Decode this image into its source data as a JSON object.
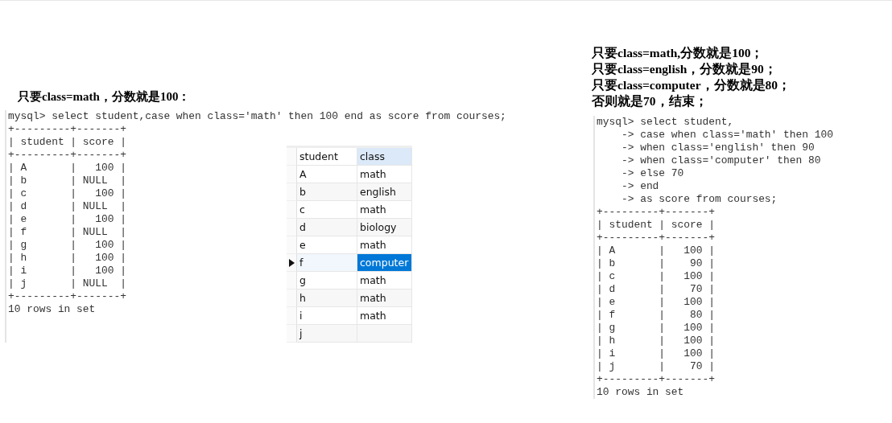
{
  "left": {
    "note": "只要class=math，分数就是100：",
    "command": "mysql> select student,case when class='math' then 100 end as score from courses;",
    "output": [
      "+---------+-------+",
      "| student | score |",
      "+---------+-------+",
      "| A       |   100 |",
      "| b       | NULL  |",
      "| c       |   100 |",
      "| d       | NULL  |",
      "| e       |   100 |",
      "| f       | NULL  |",
      "| g       |   100 |",
      "| h       |   100 |",
      "| i       |   100 |",
      "| j       | NULL  |",
      "+---------+-------+",
      "10 rows in set"
    ]
  },
  "grid": {
    "columns": [
      {
        "label": "student",
        "selected": false
      },
      {
        "label": "class",
        "selected": true
      }
    ],
    "rows": [
      {
        "student": "A",
        "class": "math",
        "selected": false
      },
      {
        "student": "b",
        "class": "english",
        "selected": false
      },
      {
        "student": "c",
        "class": "math",
        "selected": false
      },
      {
        "student": "d",
        "class": "biology",
        "selected": false
      },
      {
        "student": "e",
        "class": "math",
        "selected": false
      },
      {
        "student": "f",
        "class": "computer",
        "selected": true
      },
      {
        "student": "g",
        "class": "math",
        "selected": false
      },
      {
        "student": "h",
        "class": "math",
        "selected": false
      },
      {
        "student": "i",
        "class": "math",
        "selected": false
      },
      {
        "student": "j",
        "class": "",
        "selected": false
      }
    ]
  },
  "right": {
    "notes": [
      "只要class=math,分数就是100；",
      "只要class=english，分数就是90；",
      "只要class=computer，分数就是80；",
      "否则就是70，结束；"
    ],
    "lines": [
      "mysql> select student,",
      "    -> case when class='math' then 100",
      "    -> when class='english' then 90",
      "    -> when class='computer' then 80",
      "    -> else 70",
      "    -> end",
      "    -> as score from courses;",
      "+---------+-------+",
      "| student | score |",
      "+---------+-------+",
      "| A       |   100 |",
      "| b       |    90 |",
      "| c       |   100 |",
      "| d       |    70 |",
      "| e       |   100 |",
      "| f       |    80 |",
      "| g       |   100 |",
      "| h       |   100 |",
      "| i       |   100 |",
      "| j       |    70 |",
      "+---------+-------+",
      "10 rows in set"
    ]
  }
}
